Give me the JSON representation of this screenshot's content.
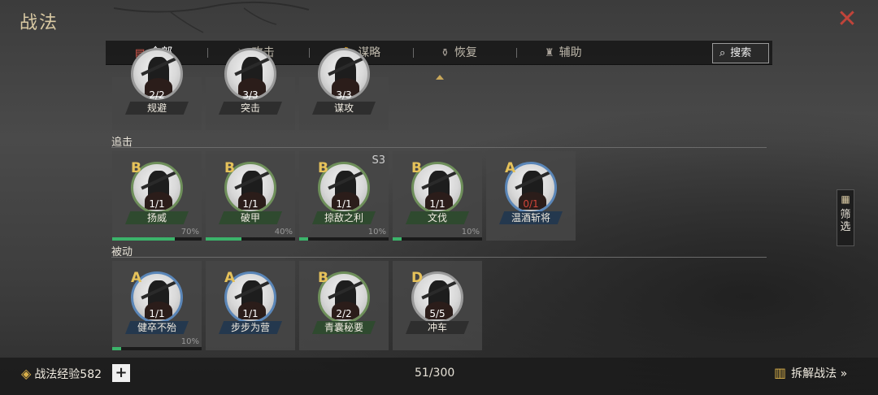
{
  "window": {
    "title": "战法",
    "close_icon": "close-icon"
  },
  "tabs": [
    {
      "label": "全部",
      "icon": "scroll-icon",
      "active": true
    },
    {
      "label": "攻击",
      "icon": "crossed-swords-icon",
      "active": false
    },
    {
      "label": "谋略",
      "icon": "hand-icon",
      "active": false
    },
    {
      "label": "恢复",
      "icon": "pot-icon",
      "active": false
    },
    {
      "label": "辅助",
      "icon": "bag-icon",
      "active": false
    }
  ],
  "search": {
    "label": "搜索"
  },
  "sections": [
    {
      "label": "",
      "cards": [
        {
          "count": "2/2",
          "name": "规避"
        },
        {
          "count": "3/3",
          "name": "突击"
        },
        {
          "count": "3/3",
          "name": "谋攻"
        }
      ]
    },
    {
      "label": "追击",
      "cards": [
        {
          "grade": "B",
          "count": "1/1",
          "name": "扬威",
          "progress": 0.7,
          "pct": "70%"
        },
        {
          "grade": "B",
          "count": "1/1",
          "name": "破甲",
          "progress": 0.4,
          "pct": "40%"
        },
        {
          "grade": "B",
          "count": "1/1",
          "name": "掠敌之利",
          "progress": 0.1,
          "pct": "10%",
          "tag": "S3"
        },
        {
          "grade": "B",
          "count": "1/1",
          "name": "文伐",
          "progress": 0.1,
          "pct": "10%"
        },
        {
          "grade": "A",
          "count": "0/1",
          "name": "温酒斩将"
        }
      ]
    },
    {
      "label": "被动",
      "cards": [
        {
          "grade": "A",
          "count": "1/1",
          "name": "健卒不殆",
          "progress": 0.1,
          "pct": "10%"
        },
        {
          "grade": "A",
          "count": "1/1",
          "name": "步步为营"
        },
        {
          "grade": "B",
          "count": "2/2",
          "name": "青囊秘要"
        },
        {
          "grade": "D",
          "count": "5/5",
          "name": "冲车"
        }
      ]
    }
  ],
  "filter": {
    "label": "筛选",
    "icon": "grid-icon"
  },
  "footer": {
    "exp_label": "战法经验582",
    "plus_label": "+",
    "capacity": "51/300",
    "dismantle_label": "拆解战法 »"
  },
  "colors": {
    "active_tab_icon": "#d9584c",
    "progress": "#3bb36a",
    "grade": "#e6c25a",
    "close": "#c0443a"
  }
}
